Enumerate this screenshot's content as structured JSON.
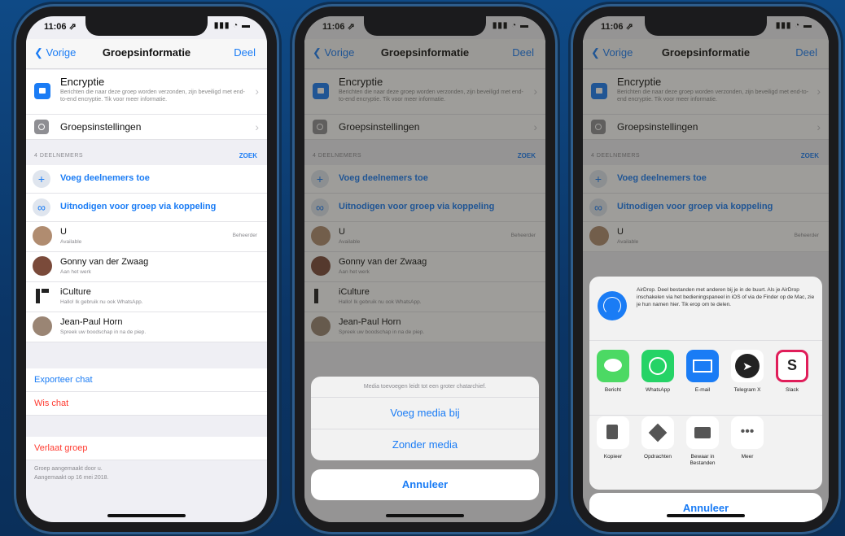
{
  "status": {
    "time": "11:06 ⇗",
    "system": "▮▮▮ ◔ ▬"
  },
  "nav": {
    "back": "❮ Vorige",
    "title": "Groepsinformatie",
    "share": "Deel"
  },
  "encryption": {
    "title": "Encryptie",
    "description": "Berichten die naar deze groep worden verzonden, zijn beveiligd met end-to-end encryptie. Tik voor meer informatie."
  },
  "settings": {
    "title": "Groepsinstellingen"
  },
  "participants": {
    "section_label": "4 DEELNEMERS",
    "search": "ZOEK"
  },
  "add_participants": "Voeg deelnemers toe",
  "invite_link": "Uitnodigen voor groep via koppeling",
  "members": [
    {
      "name": "U",
      "status": "Available",
      "role": "Beheerder"
    },
    {
      "name": "Gonny van der Zwaag",
      "status": "Aan het werk",
      "role": ""
    },
    {
      "name": "iCulture",
      "status": "Hallo! Ik gebruik nu ook WhatsApp.",
      "role": ""
    },
    {
      "name": "Jean-Paul Horn",
      "status": "Spreek uw boodschap in na de piep.",
      "role": ""
    }
  ],
  "actions": {
    "export": "Exporteer chat",
    "clear": "Wis chat",
    "leave": "Verlaat groep"
  },
  "footer": {
    "line1": "Groep aangemaakt door u.",
    "line2": "Aangemaakt op 16 mei 2018."
  },
  "media_sheet": {
    "header": "Media toevoegen leidt tot een groter chatarchief.",
    "with_media": "Voeg media bij",
    "without_media": "Zonder media",
    "cancel": "Annuleer"
  },
  "share_sheet": {
    "airdrop_text": "AirDrop. Deel bestanden met anderen bij je in de buurt. Als je AirDrop inschakelen via het bedieningspaneel in iOS of via de Finder op de Mac, zie je hun namen hier. Tik erop om te delen.",
    "apps": [
      {
        "label": "Bericht",
        "icon": "messages-icon",
        "color": "#4cd964"
      },
      {
        "label": "WhatsApp",
        "icon": "whatsapp-icon",
        "color": "#25d366"
      },
      {
        "label": "E-mail",
        "icon": "mail-icon",
        "color": "#1a7cf5"
      },
      {
        "label": "Telegram X",
        "icon": "telegram-icon",
        "color": "#222222"
      },
      {
        "label": "Slack",
        "icon": "slack-icon",
        "color": "#ffffff"
      }
    ],
    "actions": [
      {
        "label": "Kopieer",
        "icon": "copy-icon"
      },
      {
        "label": "Opdrachten",
        "icon": "shortcuts-icon"
      },
      {
        "label": "Bewaar in Bestanden",
        "icon": "folder-icon"
      },
      {
        "label": "Meer",
        "icon": "more-icon"
      }
    ],
    "cancel": "Annuleer"
  }
}
